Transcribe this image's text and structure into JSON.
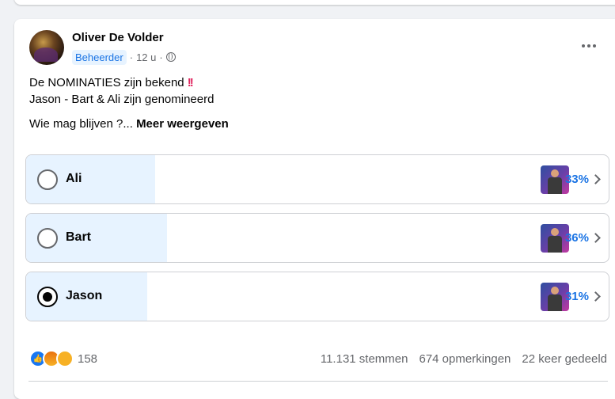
{
  "post": {
    "author": "Oliver De Volder",
    "role_badge": "Beheerder",
    "time": "12 u",
    "separator": "·",
    "text_line1": "De NOMINATIES zijn bekend",
    "text_emoji": "!!",
    "text_line2": "Jason - Bart & Ali zijn genomineerd",
    "text_line3": "Wie mag blijven ?...",
    "see_more": "Meer weergeven"
  },
  "poll": {
    "options": [
      {
        "label": "Ali",
        "percent_label": "33%",
        "percent": 33,
        "selected": false
      },
      {
        "label": "Bart",
        "percent_label": "36%",
        "percent": 36,
        "selected": false
      },
      {
        "label": "Jason",
        "percent_label": "31%",
        "percent": 31,
        "selected": true
      }
    ]
  },
  "footer": {
    "reaction_icons": [
      "like-icon",
      "angry-icon",
      "sad-icon"
    ],
    "reaction_count": "158",
    "votes": "11.131 stemmen",
    "comments": "674 opmerkingen",
    "shares": "22 keer gedeeld"
  },
  "colors": {
    "accent": "#1b74e4",
    "poll_fill": "#e7f3ff"
  }
}
